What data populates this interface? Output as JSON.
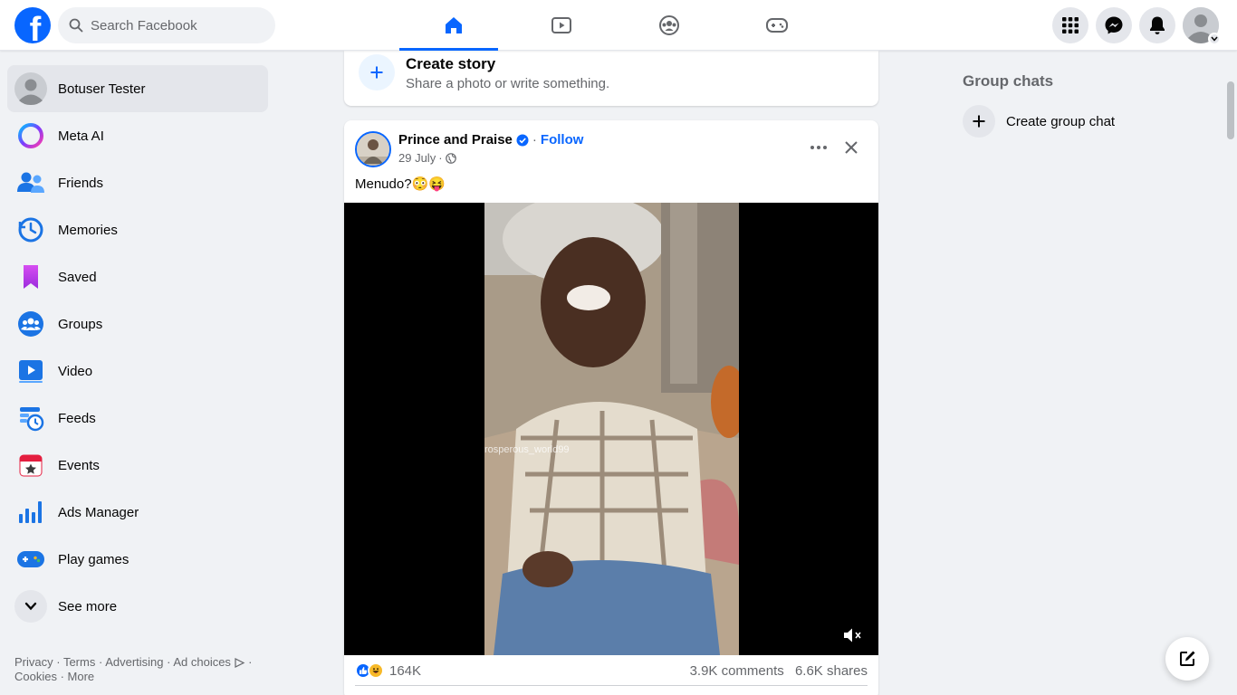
{
  "header": {
    "logo_letter": "f",
    "search_placeholder": "Search Facebook",
    "tabs": [
      {
        "name": "home",
        "icon": "home-icon",
        "active": true
      },
      {
        "name": "video",
        "icon": "video-play-icon",
        "active": false
      },
      {
        "name": "groups",
        "icon": "groups-icon",
        "active": false
      },
      {
        "name": "gaming",
        "icon": "gamepad-icon",
        "active": false
      }
    ],
    "right_icons": [
      "menu-grid-icon",
      "messenger-icon",
      "bell-icon",
      "profile-avatar"
    ]
  },
  "sidebar": {
    "items": [
      {
        "label": "Botuser Tester",
        "icon": "user-avatar-icon"
      },
      {
        "label": "Meta AI",
        "icon": "meta-ai-icon"
      },
      {
        "label": "Friends",
        "icon": "friends-icon"
      },
      {
        "label": "Memories",
        "icon": "memories-clock-icon"
      },
      {
        "label": "Saved",
        "icon": "bookmark-icon"
      },
      {
        "label": "Groups",
        "icon": "groups-icon"
      },
      {
        "label": "Video",
        "icon": "video-icon"
      },
      {
        "label": "Feeds",
        "icon": "feeds-icon"
      },
      {
        "label": "Events",
        "icon": "calendar-star-icon"
      },
      {
        "label": "Ads Manager",
        "icon": "bar-chart-icon"
      },
      {
        "label": "Play games",
        "icon": "gamepad-icon"
      },
      {
        "label": "See more",
        "icon": "chevron-down-icon"
      }
    ],
    "footer": {
      "privacy": "Privacy",
      "terms": "Terms",
      "advertising": "Advertising",
      "ad_choices": "Ad choices",
      "cookies": "Cookies",
      "more": "More"
    }
  },
  "story": {
    "title": "Create story",
    "subtitle": "Share a photo or write something."
  },
  "post": {
    "author": "Prince and Praise",
    "follow": "Follow",
    "date": "29 July",
    "text": "Menudo?😳😝",
    "watermark": "rosperous_world99",
    "reaction_count": "164K",
    "comments": "3.9K comments",
    "shares": "6.6K shares"
  },
  "right": {
    "group_chats_title": "Group chats",
    "create_group_label": "Create group chat"
  },
  "colors": {
    "brand_blue": "#0866ff",
    "background": "#f0f2f5",
    "text_secondary": "#65676b"
  }
}
